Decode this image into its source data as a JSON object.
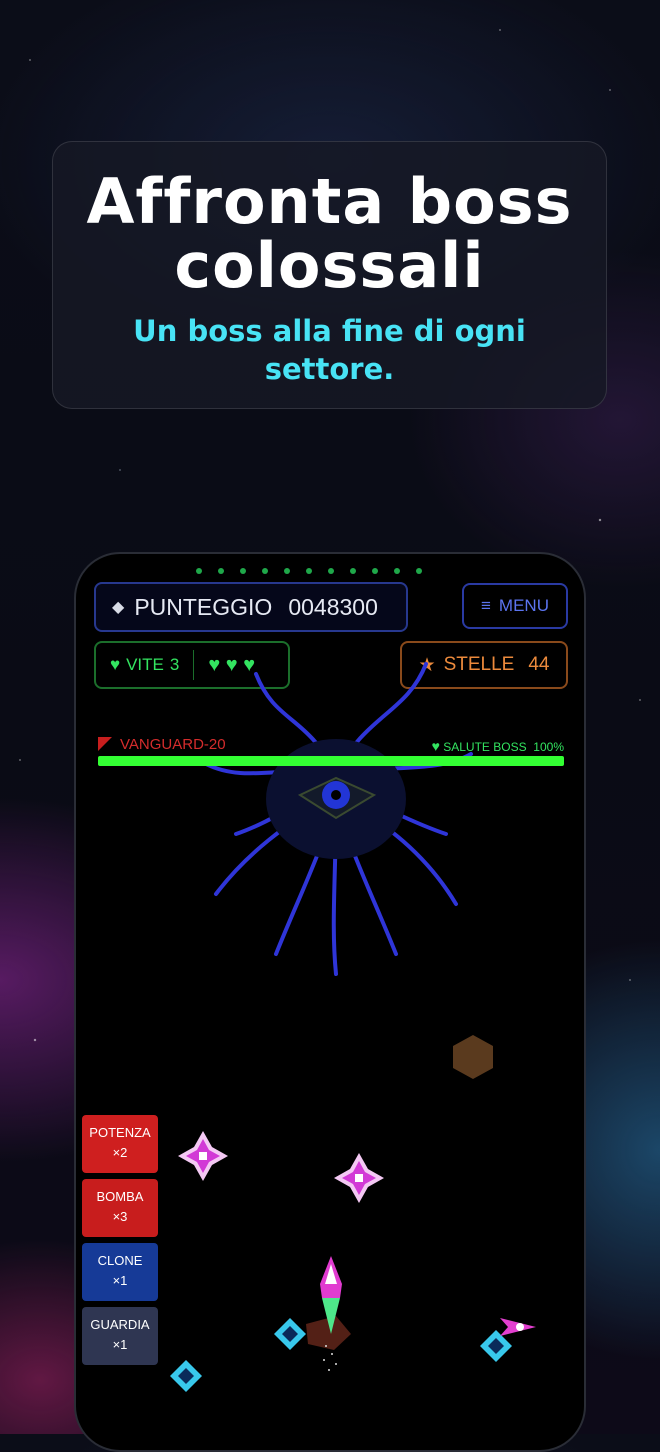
{
  "banner": {
    "title": "Affronta boss colossali",
    "subtitle": "Un boss alla fine di ogni settore."
  },
  "hud": {
    "score_label": "PUNTEGGIO",
    "score_value": "0048300",
    "menu_label": "MENU",
    "lives_label": "VITE",
    "lives_value": "3",
    "lives_hearts": "♥ ♥ ♥",
    "stars_label": "STELLE",
    "stars_value": "44"
  },
  "boss": {
    "name": "VANGUARD-20",
    "health_label": "SALUTE BOSS",
    "health_value": "100%",
    "health_fraction": 1.0
  },
  "powerups": [
    {
      "name": "POTENZA",
      "count": "×2"
    },
    {
      "name": "BOMBA",
      "count": "×3"
    },
    {
      "name": "CLONE",
      "count": "×1"
    },
    {
      "name": "GUARDIA",
      "count": "×1"
    }
  ],
  "colors": {
    "accent_cyan": "#48e3f5",
    "health_green": "#33ff33",
    "boss_red": "#d42c2c",
    "stars_orange": "#ec8a3c"
  },
  "icons": [
    "diamond-icon",
    "menu-icon",
    "heart-icon",
    "star-icon",
    "flag-icon"
  ]
}
